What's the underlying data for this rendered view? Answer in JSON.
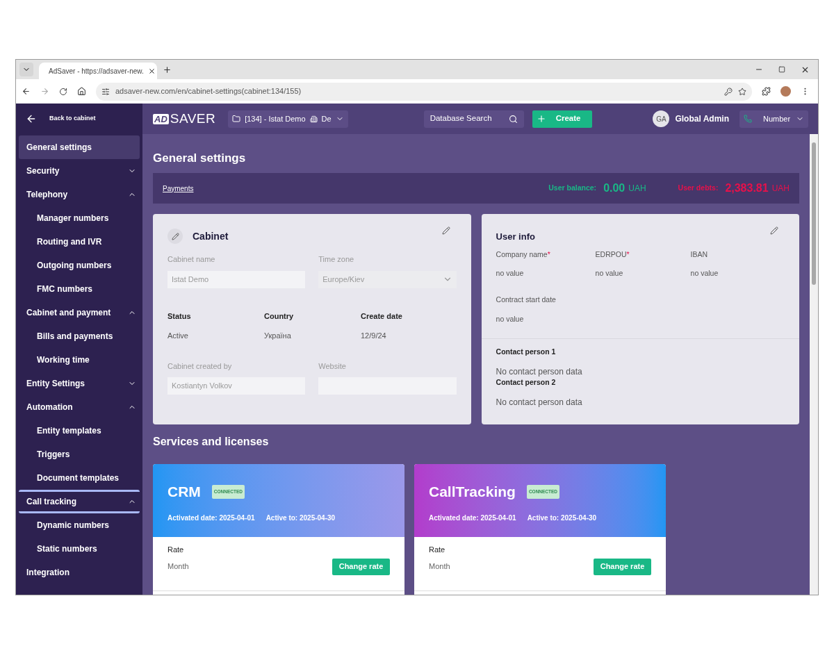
{
  "browser": {
    "tab_title": "AdSaver - https://adsaver-new.",
    "url": "adsaver-new.com/en/cabinet-settings(cabinet:134/155)"
  },
  "sidebar": {
    "back_label": "Back to cabinet",
    "items": [
      {
        "label": "General settings",
        "selected": true,
        "focused": false
      },
      {
        "label": "Security",
        "selected": false,
        "focused": false,
        "expanded": false
      },
      {
        "label": "Telephony",
        "selected": false,
        "focused": false,
        "expanded": true,
        "children": [
          {
            "label": "Manager numbers"
          },
          {
            "label": "Routing and IVR"
          },
          {
            "label": "Outgoing numbers"
          },
          {
            "label": "FMC numbers"
          }
        ]
      },
      {
        "label": "Cabinet and payment",
        "selected": false,
        "focused": false,
        "expanded": true,
        "children": [
          {
            "label": "Bills and payments"
          },
          {
            "label": "Working time"
          }
        ]
      },
      {
        "label": "Entity Settings",
        "selected": false,
        "focused": false,
        "expanded": false
      },
      {
        "label": "Automation",
        "selected": false,
        "focused": false,
        "expanded": true,
        "children": [
          {
            "label": "Entity templates"
          },
          {
            "label": "Triggers"
          },
          {
            "label": "Document templates"
          }
        ]
      },
      {
        "label": "Call tracking",
        "selected": false,
        "focused": true,
        "expanded": true,
        "children": [
          {
            "label": "Dynamic numbers"
          },
          {
            "label": "Static numbers"
          }
        ]
      },
      {
        "label": "Integration",
        "selected": false,
        "focused": false
      }
    ]
  },
  "header": {
    "logo_mark": "AD",
    "logo_text": "SAVER",
    "cabinet": "[134] - Istat Demo",
    "cabinet_suffix": "De",
    "search_placeholder": "Database Search",
    "create_label": "Create",
    "user_initials": "GA",
    "user_name": "Global Admin",
    "number_label": "Number"
  },
  "page_title": "General settings",
  "payments": {
    "link": "Payments",
    "balance_label": "User balance:",
    "balance_value": "0.00",
    "balance_currency": "UAH",
    "debts_label": "User debts:",
    "debts_value": "2,383.81",
    "debts_currency": "UAH"
  },
  "cabinet_card": {
    "title": "Cabinet",
    "name_label": "Cabinet name",
    "name_value": "Istat Demo",
    "timezone_label": "Time zone",
    "timezone_value": "Europe/Kiev",
    "info": [
      {
        "label": "Status",
        "value": "Active"
      },
      {
        "label": "Country",
        "value": "Україна"
      },
      {
        "label": "Create date",
        "value": "12/9/24"
      }
    ],
    "created_by_label": "Cabinet created by",
    "created_by_value": "Kostiantyn Volkov",
    "website_label": "Website"
  },
  "user_card": {
    "title": "User info",
    "required_mark": "*",
    "fields": [
      {
        "label": "Company name",
        "required": true,
        "value": "no value"
      },
      {
        "label": "EDRPOU",
        "required": true,
        "value": "no value"
      },
      {
        "label": "IBAN",
        "required": false,
        "value": "no value"
      },
      {
        "label": "Contract start date",
        "required": false,
        "value": "no value"
      }
    ],
    "contacts": [
      {
        "title": "Contact person 1",
        "text": "No contact person data"
      },
      {
        "title": "Contact person 2",
        "text": "No contact person data"
      }
    ]
  },
  "services_title": "Services and licenses",
  "services": [
    {
      "name": "CRM",
      "kind": "blue",
      "status": "CONNECTED",
      "activated": "Activated date: 2025-04-01",
      "active_to": "Active to: 2025-04-30",
      "rate_label": "Rate",
      "rate_value": "Month",
      "button": "Change rate"
    },
    {
      "name": "CallTracking",
      "kind": "purple",
      "status": "CONNECTED",
      "activated": "Activated date: 2025-04-01",
      "active_to": "Active to: 2025-04-30",
      "rate_label": "Rate",
      "rate_value": "Month",
      "button": "Change rate"
    }
  ]
}
